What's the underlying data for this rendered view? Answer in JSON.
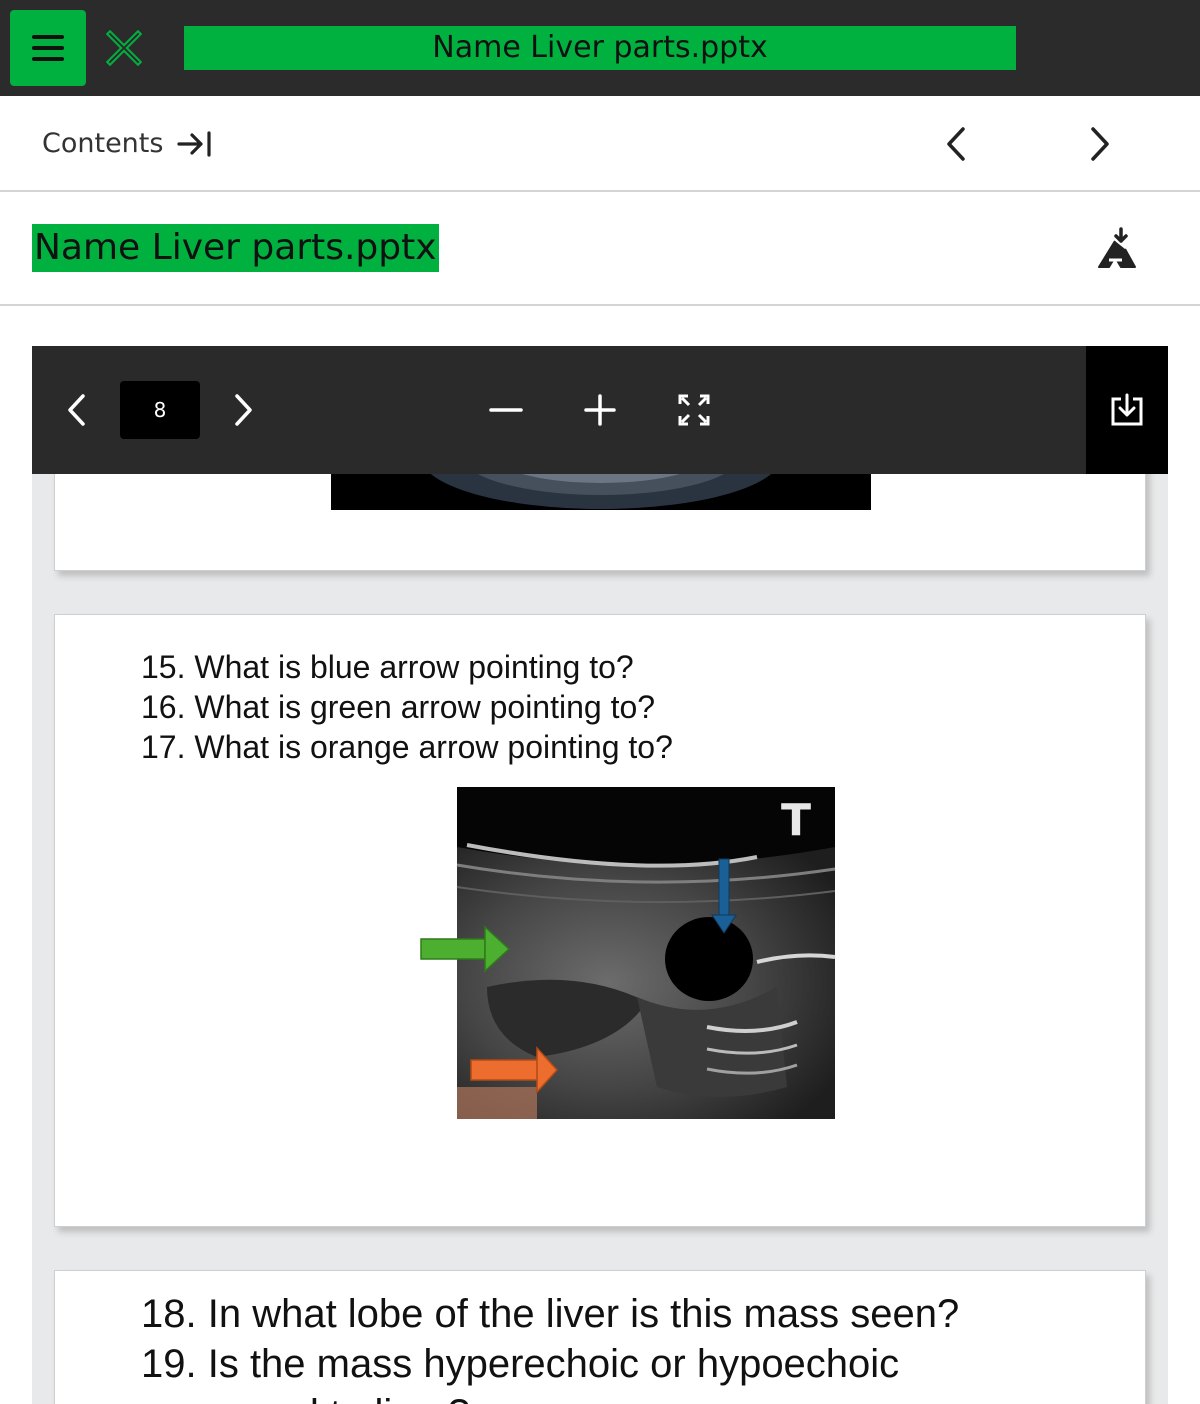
{
  "app": {
    "title": "Name Liver parts.pptx",
    "accent_color": "#00b140"
  },
  "nav": {
    "contents_label": "Contents",
    "prev_icon": "chevron-left-icon",
    "next_icon": "chevron-right-icon"
  },
  "document": {
    "title": "Name Liver parts.pptx"
  },
  "viewer": {
    "page_number": "8",
    "toolbar_icons": [
      "chevron-left-icon",
      "chevron-right-icon",
      "zoom-out-icon",
      "zoom-in-icon",
      "fullscreen-icon",
      "download-icon"
    ]
  },
  "slides": {
    "slide2": {
      "questions": [
        "15. What is blue arrow pointing to?",
        "16. What is green arrow pointing to?",
        "17. What is orange arrow pointing to?"
      ],
      "image_label": "T",
      "arrow_colors": {
        "blue": "#1a5f96",
        "green": "#4caf2f",
        "orange": "#ec6d2d"
      }
    },
    "slide3": {
      "questions": [
        "18. In what lobe of the liver is this mass seen?",
        "19. Is the mass hyperechoic or hypoechoic",
        "compared to liver?"
      ]
    }
  }
}
